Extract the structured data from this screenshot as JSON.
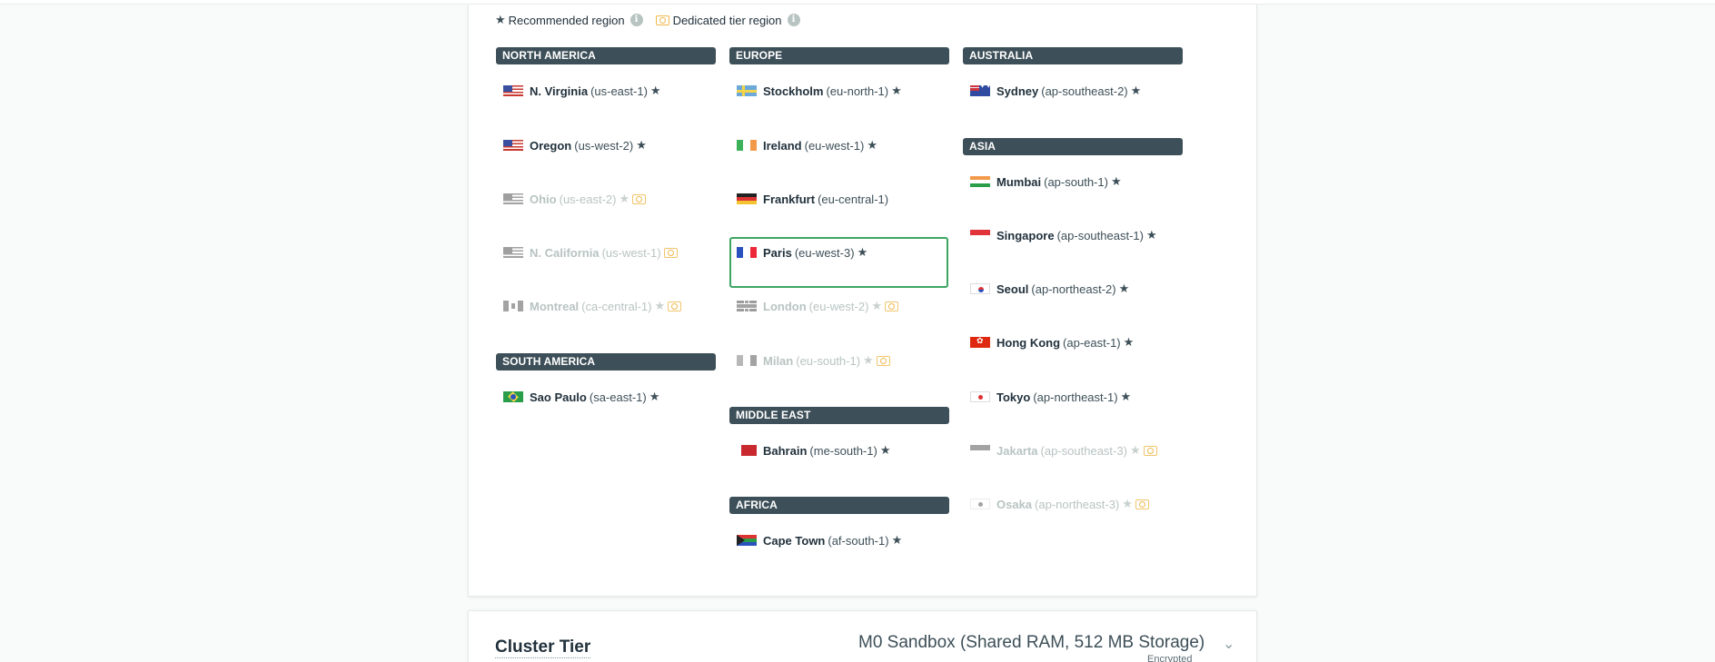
{
  "legend": {
    "recommended_label": "Recommended region",
    "dedicated_label": "Dedicated tier region"
  },
  "sections": {
    "north_america": "NORTH AMERICA",
    "south_america": "SOUTH AMERICA",
    "europe": "EUROPE",
    "middle_east": "MIDDLE EAST",
    "africa": "AFRICA",
    "australia": "AUSTRALIA",
    "asia": "ASIA"
  },
  "regions": {
    "virginia": {
      "city": "N. Virginia",
      "code": "(us-east-1)",
      "star": "★"
    },
    "oregon": {
      "city": "Oregon",
      "code": "(us-west-2)",
      "star": "★"
    },
    "ohio": {
      "city": "Ohio",
      "code": "(us-east-2)",
      "star": "★"
    },
    "california": {
      "city": "N. California",
      "code": "(us-west-1)"
    },
    "montreal": {
      "city": "Montreal",
      "code": "(ca-central-1)",
      "star": "★"
    },
    "saopaulo": {
      "city": "Sao Paulo",
      "code": "(sa-east-1)",
      "star": "★"
    },
    "stockholm": {
      "city": "Stockholm",
      "code": "(eu-north-1)",
      "star": "★"
    },
    "ireland": {
      "city": "Ireland",
      "code": "(eu-west-1)",
      "star": "★"
    },
    "frankfurt": {
      "city": "Frankfurt",
      "code": "(eu-central-1)"
    },
    "paris": {
      "city": "Paris",
      "code": "(eu-west-3)",
      "star": "★"
    },
    "london": {
      "city": "London",
      "code": "(eu-west-2)",
      "star": "★"
    },
    "milan": {
      "city": "Milan",
      "code": "(eu-south-1)",
      "star": "★"
    },
    "bahrain": {
      "city": "Bahrain",
      "code": "(me-south-1)",
      "star": "★"
    },
    "capetown": {
      "city": "Cape Town",
      "code": "(af-south-1)",
      "star": "★"
    },
    "sydney": {
      "city": "Sydney",
      "code": "(ap-southeast-2)",
      "star": "★"
    },
    "mumbai": {
      "city": "Mumbai",
      "code": "(ap-south-1)",
      "star": "★"
    },
    "singapore": {
      "city": "Singapore",
      "code": "(ap-southeast-1)",
      "star": "★"
    },
    "seoul": {
      "city": "Seoul",
      "code": "(ap-northeast-2)",
      "star": "★"
    },
    "hongkong": {
      "city": "Hong Kong",
      "code": "(ap-east-1)",
      "star": "★"
    },
    "tokyo": {
      "city": "Tokyo",
      "code": "(ap-northeast-1)",
      "star": "★"
    },
    "jakarta": {
      "city": "Jakarta",
      "code": "(ap-southeast-3)",
      "star": "★"
    },
    "osaka": {
      "city": "Osaka",
      "code": "(ap-northeast-3)",
      "star": "★"
    }
  },
  "selected_region": "Paris",
  "cluster_tier": {
    "title": "Cluster Tier",
    "value": "M0 Sandbox (Shared RAM, 512 MB Storage)",
    "sub": "Encrypted"
  },
  "icons": {
    "star": "star-icon",
    "info": "info-icon",
    "dedicated": "dedicated-tier-icon",
    "chevron": "chevron-down-icon"
  },
  "colors": {
    "section_header_bg": "#3d4f58",
    "selected_border": "#3ea563",
    "dedicated_icon": "#f0b84b",
    "disabled_text": "#b8c4c2"
  }
}
